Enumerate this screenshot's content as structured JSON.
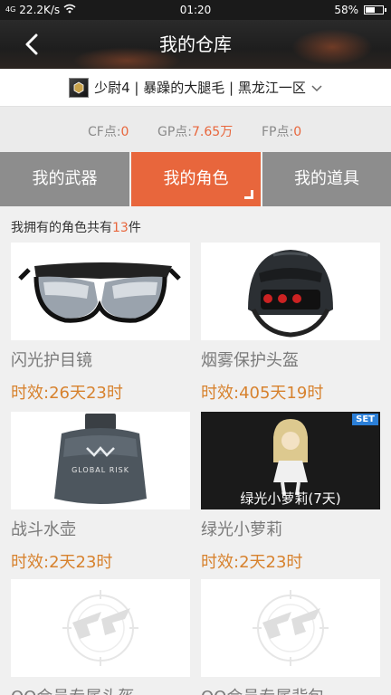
{
  "status_bar": {
    "signal": "4G",
    "net_speed": "22.2K/s",
    "time": "01:20",
    "battery": "58%",
    "battery_level": 0.58
  },
  "header": {
    "title": "我的仓库"
  },
  "account": {
    "text": "少尉4 | 暴躁的大腿毛 | 黑龙江一区"
  },
  "points": {
    "cf": {
      "label": "CF点:",
      "value": "0"
    },
    "gp": {
      "label": "GP点:",
      "value": "7.65万"
    },
    "fp": {
      "label": "FP点:",
      "value": "0"
    }
  },
  "tabs": [
    {
      "label": "我的武器",
      "active": false
    },
    {
      "label": "我的角色",
      "active": true
    },
    {
      "label": "我的道具",
      "active": false
    }
  ],
  "summary": {
    "prefix": "我拥有的角色共有",
    "count": "13",
    "suffix": "件"
  },
  "items": [
    {
      "name": "闪光护目镜",
      "time": "时效:26天23时",
      "icon": "goggles"
    },
    {
      "name": "烟雾保护头盔",
      "time": "时效:405天19时",
      "icon": "helmet"
    },
    {
      "name": "战斗水壶",
      "time": "时效:2天23时",
      "icon": "canteen",
      "logo_text": "GLOBAL RISK"
    },
    {
      "name": "绿光小萝莉",
      "time": "时效:2天23时",
      "icon": "character",
      "badge": "SET",
      "caption": "绿光小萝莉(7天)"
    },
    {
      "name": "QQ会员专属头盔",
      "time": "",
      "icon": "cf-logo"
    },
    {
      "name": "QQ会员专属背包",
      "time": "",
      "icon": "cf-logo"
    }
  ],
  "colors": {
    "accent": "#e8663c",
    "timer": "#d7822e",
    "tab_inactive": "#8d8d8d"
  }
}
